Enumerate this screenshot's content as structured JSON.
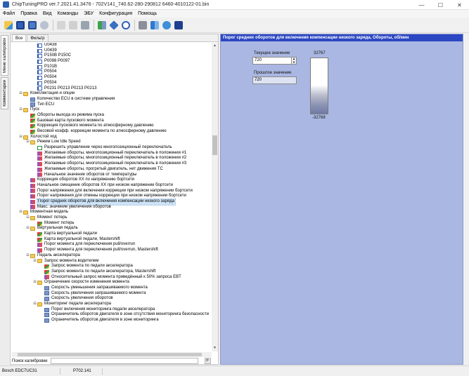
{
  "window": {
    "title": "ChipTuningPRO ver.7.2021.41.3476 - 702V141_740.62-280-290812 6460-4010122-01.bin",
    "minimize": "—",
    "maximize": "☐",
    "close": "✕"
  },
  "menu": [
    "Файл",
    "Правка",
    "Вид",
    "Команды",
    "ЭБУ",
    "Конфигурация",
    "Помощь"
  ],
  "toolbar": {
    "icons": [
      "open-file-icon",
      "save-icon",
      "save-as-icon",
      "undo-icon",
      "copy-icon",
      "paste-icon",
      "calculator-icon",
      "checksum-icon",
      "diamond-icon",
      "search-icon",
      "tools-icon",
      "compare-icon",
      "globe-icon",
      "help-icon"
    ]
  },
  "side_tabs": [
    "Меню калибровок",
    "Комментарии"
  ],
  "left_tabs": [
    "Все",
    "Фильтр"
  ],
  "tree": [
    {
      "indent": 3,
      "exp": "",
      "icon": "dtc",
      "label": "U0438"
    },
    {
      "indent": 3,
      "exp": "",
      "icon": "dtc",
      "label": "U0439"
    },
    {
      "indent": 3,
      "exp": "",
      "icon": "dtc",
      "label": "P150B P150C"
    },
    {
      "indent": 3,
      "exp": "",
      "icon": "dtc",
      "label": "P0098 P0097"
    },
    {
      "indent": 3,
      "exp": "",
      "icon": "dtc",
      "label": "P101B"
    },
    {
      "indent": 3,
      "exp": "",
      "icon": "dtc",
      "label": "P0504"
    },
    {
      "indent": 3,
      "exp": "",
      "icon": "dtc",
      "label": "P0504"
    },
    {
      "indent": 3,
      "exp": "",
      "icon": "dtc",
      "label": "P0504"
    },
    {
      "indent": 3,
      "exp": "",
      "icon": "dtc",
      "label": "P0231 P0213 P0213 P0213"
    },
    {
      "indent": 1,
      "exp": "⊟",
      "icon": "folder",
      "label": "Комплектация и опции"
    },
    {
      "indent": 2,
      "exp": "",
      "icon": "val",
      "label": "Количество ECU в системе управления"
    },
    {
      "indent": 2,
      "exp": "",
      "icon": "val",
      "label": "Тип ECU"
    },
    {
      "indent": 1,
      "exp": "⊟",
      "icon": "folder",
      "label": "Пуск"
    },
    {
      "indent": 2,
      "exp": "",
      "icon": "map",
      "label": "Обороты выхода из режима пуска"
    },
    {
      "indent": 2,
      "exp": "",
      "icon": "map",
      "label": "Базовая карта пускового момента"
    },
    {
      "indent": 2,
      "exp": "",
      "icon": "map",
      "label": "Коррекция пускового момента по атмосферному давлению"
    },
    {
      "indent": 2,
      "exp": "",
      "icon": "map",
      "label": "Весовой коэфф. коррекции момента по атмосферному давлению"
    },
    {
      "indent": 1,
      "exp": "⊟",
      "icon": "folder",
      "label": "Холостой ход"
    },
    {
      "indent": 2,
      "exp": "⊟",
      "icon": "folder",
      "label": "Режим Low Idle Speed"
    },
    {
      "indent": 3,
      "exp": "",
      "icon": "chk",
      "label": "Разрешить управление через многопозиционный переключатель"
    },
    {
      "indent": 3,
      "exp": "",
      "icon": "tbl",
      "label": "Желаемые обороты, многопозиционный переключатель в положении #1"
    },
    {
      "indent": 3,
      "exp": "",
      "icon": "tbl",
      "label": "Желаемые обороты, многопозиционный переключатель в положении #2"
    },
    {
      "indent": 3,
      "exp": "",
      "icon": "tbl",
      "label": "Желаемые обороты, многопозиционный переключатель в положении #3"
    },
    {
      "indent": 3,
      "exp": "",
      "icon": "tbl",
      "label": "Желаемые обороты, прогретый двигатель, нет движения ТС"
    },
    {
      "indent": 3,
      "exp": "",
      "icon": "tbl",
      "label": "Начальное значение оборотов от температуры"
    },
    {
      "indent": 2,
      "exp": "",
      "icon": "tbl",
      "label": "Коррекция оборотов ХХ по напряжению бортсети"
    },
    {
      "indent": 2,
      "exp": "",
      "icon": "tbl",
      "label": "Начальное смещение оборотов ХХ при низком напряжении бортсети"
    },
    {
      "indent": 2,
      "exp": "",
      "icon": "tbl",
      "label": "Порог напряжения для включения коррекции при низком напряжении бортсети"
    },
    {
      "indent": 2,
      "exp": "",
      "icon": "tbl",
      "label": "Порог напряжения для отмены коррекции при низком напряжении бортсети"
    },
    {
      "indent": 2,
      "exp": "",
      "icon": "tbl",
      "label": "Порог средних оборотов для включения компенсации низкого заряда",
      "selected": true
    },
    {
      "indent": 2,
      "exp": "",
      "icon": "tbl",
      "label": "Макс. значение увеличения оборотов"
    },
    {
      "indent": 1,
      "exp": "⊟",
      "icon": "folder",
      "label": "Моментная модель"
    },
    {
      "indent": 2,
      "exp": "⊟",
      "icon": "folder",
      "label": "Момент потерь"
    },
    {
      "indent": 3,
      "exp": "",
      "icon": "map",
      "label": "Момент потерь"
    },
    {
      "indent": 2,
      "exp": "⊟",
      "icon": "folder",
      "label": "Виртуальная педаль"
    },
    {
      "indent": 3,
      "exp": "",
      "icon": "map",
      "label": "Карта виртуальной педали"
    },
    {
      "indent": 3,
      "exp": "",
      "icon": "map",
      "label": "Карта виртуальной педали, Mastershift"
    },
    {
      "indent": 3,
      "exp": "",
      "icon": "tbl",
      "label": "Порог момента для переключения pull/overrun"
    },
    {
      "indent": 3,
      "exp": "",
      "icon": "tbl",
      "label": "Порог момента для переключения pull/overrun, Mastershift"
    },
    {
      "indent": 2,
      "exp": "⊟",
      "icon": "folder",
      "label": "Педаль акселератора"
    },
    {
      "indent": 3,
      "exp": "⊟",
      "icon": "folder",
      "label": "Запрос момента водителем"
    },
    {
      "indent": 4,
      "exp": "",
      "icon": "map",
      "label": "Запрос момента по педали акселератора"
    },
    {
      "indent": 4,
      "exp": "",
      "icon": "map",
      "label": "Запрос момента по педали акселератора, Mastershift"
    },
    {
      "indent": 4,
      "exp": "",
      "icon": "tbl",
      "label": "Относительный запрос момента приведённый к 50% запроса EBT"
    },
    {
      "indent": 3,
      "exp": "⊟",
      "icon": "folder",
      "label": "Ограничение скорости изменения момента"
    },
    {
      "indent": 4,
      "exp": "",
      "icon": "val",
      "label": "Скорость уменьшения запрашиваемого момента"
    },
    {
      "indent": 4,
      "exp": "",
      "icon": "val",
      "label": "Скорость увеличения запрашиваемого момента"
    },
    {
      "indent": 4,
      "exp": "",
      "icon": "val",
      "label": "Скорость увеличения оборотов"
    },
    {
      "indent": 3,
      "exp": "⊟",
      "icon": "folder",
      "label": "Мониторинг педали акселератора"
    },
    {
      "indent": 4,
      "exp": "",
      "icon": "val",
      "label": "Порог включения мониторинга педали акселератора"
    },
    {
      "indent": 4,
      "exp": "",
      "icon": "val",
      "label": "Ограничитель оборотов двигателя в зоне отсутствия мониторинга безопасности"
    },
    {
      "indent": 4,
      "exp": "",
      "icon": "val",
      "label": "Ограничитель оборотов двигателя в зоне мониторинга"
    }
  ],
  "search": {
    "label": "Поиск калибровки",
    "value": ""
  },
  "detail": {
    "title": "Порог средних оборотов для включения компенсации низкого заряда, Обороты, об/мин",
    "current_label": "Текущее значение",
    "current_value": "720",
    "previous_label": "Прошлое значение",
    "previous_value": "720",
    "gauge_max": "32767",
    "gauge_min": "-32768",
    "gauge_fraction": 0.511
  },
  "status": {
    "ecu": "Bosch EDC7UC31",
    "sw": "P702.141"
  }
}
